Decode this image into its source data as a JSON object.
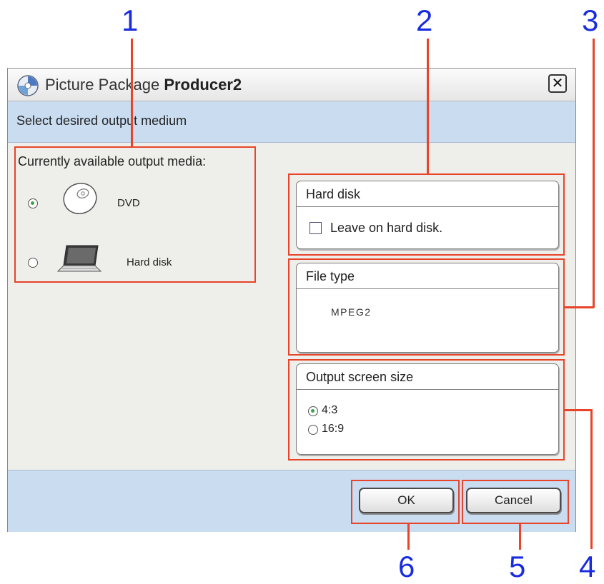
{
  "window": {
    "title_prefix": "Picture Package ",
    "title_bold": "Producer2",
    "close_glyph": "✕"
  },
  "instruction": "Select desired output medium",
  "media": {
    "label": "Currently available output media:",
    "options": [
      {
        "label": "DVD",
        "selected": true
      },
      {
        "label": "Hard disk",
        "selected": false
      }
    ]
  },
  "hard_disk_group": {
    "title": "Hard disk",
    "checkbox_label": "Leave on hard disk.",
    "checked": false
  },
  "file_type_group": {
    "title": "File type",
    "value": "MPEG2"
  },
  "screen_size_group": {
    "title": "Output screen size",
    "options": [
      {
        "label": "4:3",
        "selected": true
      },
      {
        "label": "16:9",
        "selected": false
      }
    ]
  },
  "buttons": {
    "ok": "OK",
    "cancel": "Cancel"
  },
  "callouts": [
    "1",
    "2",
    "3",
    "4",
    "5",
    "6"
  ],
  "colors": {
    "annotation": "#e8442a",
    "callout_number": "#1a2ce0",
    "bar_background": "#c9dcf0",
    "radio_selected": "#3da34a"
  }
}
